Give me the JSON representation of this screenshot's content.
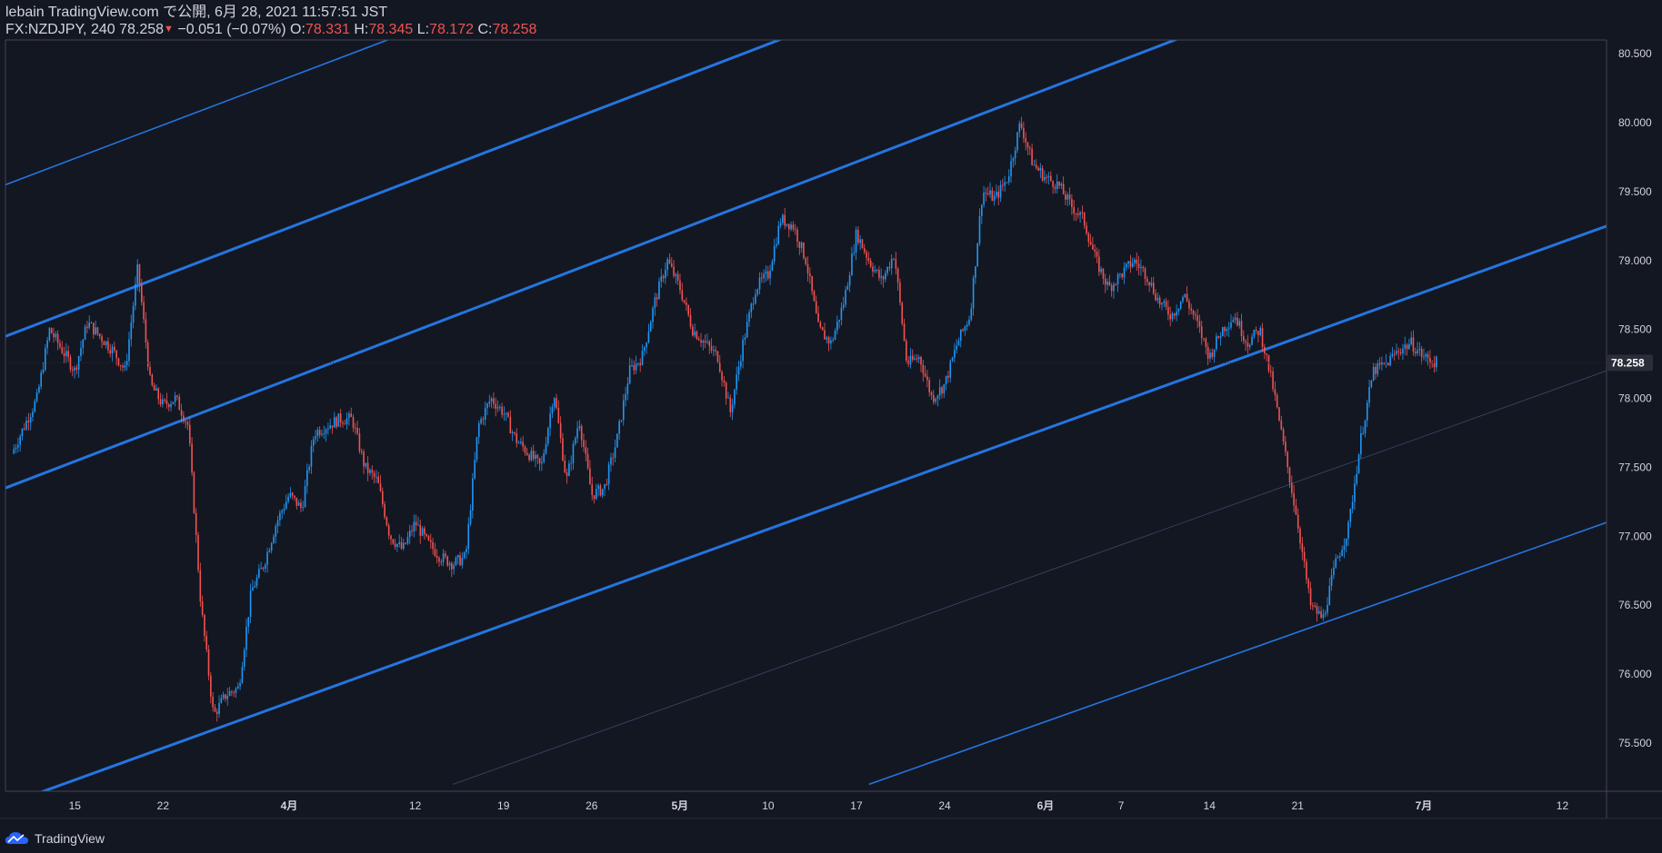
{
  "header": {
    "published_line": "lebain TradingView.com で公開, 6月 28, 2021 11:57:51 JST",
    "symbol": "FX:NZDJPY, 240",
    "last_price": "78.258",
    "change_arrow": "▼",
    "change": "−0.051 (−0.07%)",
    "o_label": "O:",
    "o_value": "78.331",
    "h_label": "H:",
    "h_value": "78.345",
    "l_label": "L:",
    "l_value": "78.172",
    "c_label": "C:",
    "c_value": "78.258"
  },
  "colors": {
    "background": "#131722",
    "up": "#2196f3",
    "down": "#ef5350",
    "channel": "#2575e0",
    "grid_text": "#d1d4dc",
    "price_label_bg": "#2a2e39"
  },
  "footer": {
    "brand": "TradingView",
    "logo_icon": "tradingview-cloud-icon"
  },
  "chart_data": {
    "type": "candlestick",
    "symbol": "FX:NZDJPY",
    "interval": "240",
    "ylim": [
      75.15,
      80.6
    ],
    "y_ticks": [
      75.5,
      76.0,
      76.5,
      77.0,
      77.5,
      78.0,
      78.5,
      79.0,
      79.5,
      80.0,
      80.5
    ],
    "y_tick_labels": [
      "75.500",
      "76.000",
      "76.500",
      "77.000",
      "77.500",
      "78.000",
      "78.500",
      "79.000",
      "79.500",
      "80.000",
      "80.500"
    ],
    "current_price": 78.258,
    "current_price_label": "78.258",
    "x_ticks": [
      {
        "label": "15",
        "day": 5
      },
      {
        "label": "22",
        "day": 12
      },
      {
        "label": "4月",
        "day": 22
      },
      {
        "label": "12",
        "day": 32
      },
      {
        "label": "19",
        "day": 39
      },
      {
        "label": "26",
        "day": 46
      },
      {
        "label": "5月",
        "day": 53
      },
      {
        "label": "10",
        "day": 60
      },
      {
        "label": "17",
        "day": 67
      },
      {
        "label": "24",
        "day": 74
      },
      {
        "label": "6月",
        "day": 82
      },
      {
        "label": "7",
        "day": 88
      },
      {
        "label": "14",
        "day": 95
      },
      {
        "label": "21",
        "day": 102
      },
      {
        "label": "7月",
        "day": 112
      },
      {
        "label": "12",
        "day": 123
      }
    ],
    "xlim": [
      -0.5,
      126.5
    ],
    "price_path": [
      [
        0,
        77.6
      ],
      [
        2,
        78.0
      ],
      [
        3,
        78.5
      ],
      [
        5,
        78.2
      ],
      [
        6,
        78.55
      ],
      [
        8,
        78.35
      ],
      [
        9,
        78.2
      ],
      [
        10,
        78.95
      ],
      [
        11,
        78.1
      ],
      [
        12,
        77.95
      ],
      [
        13,
        78.0
      ],
      [
        14,
        77.8
      ],
      [
        15,
        76.5
      ],
      [
        16,
        75.7
      ],
      [
        17,
        75.85
      ],
      [
        18,
        75.9
      ],
      [
        19,
        76.6
      ],
      [
        20,
        76.8
      ],
      [
        21,
        77.1
      ],
      [
        22,
        77.3
      ],
      [
        23,
        77.2
      ],
      [
        24,
        77.75
      ],
      [
        26,
        77.85
      ],
      [
        27,
        77.85
      ],
      [
        28,
        77.5
      ],
      [
        29,
        77.4
      ],
      [
        30,
        77.0
      ],
      [
        31,
        76.9
      ],
      [
        32,
        77.1
      ],
      [
        33,
        76.95
      ],
      [
        34,
        76.85
      ],
      [
        35,
        76.8
      ],
      [
        36,
        76.85
      ],
      [
        37,
        77.8
      ],
      [
        38,
        78.0
      ],
      [
        39,
        77.9
      ],
      [
        40,
        77.7
      ],
      [
        41,
        77.6
      ],
      [
        42,
        77.5
      ],
      [
        43,
        78.05
      ],
      [
        44,
        77.4
      ],
      [
        45,
        77.85
      ],
      [
        46,
        77.3
      ],
      [
        47,
        77.35
      ],
      [
        48,
        77.7
      ],
      [
        49,
        78.2
      ],
      [
        50,
        78.3
      ],
      [
        51,
        78.7
      ],
      [
        52,
        79.0
      ],
      [
        53,
        78.8
      ],
      [
        54,
        78.5
      ],
      [
        55,
        78.4
      ],
      [
        56,
        78.3
      ],
      [
        57,
        77.9
      ],
      [
        58,
        78.4
      ],
      [
        59,
        78.8
      ],
      [
        60,
        78.9
      ],
      [
        61,
        79.3
      ],
      [
        62,
        79.25
      ],
      [
        63,
        79.0
      ],
      [
        64,
        78.5
      ],
      [
        65,
        78.4
      ],
      [
        66,
        78.7
      ],
      [
        67,
        79.2
      ],
      [
        68,
        79.0
      ],
      [
        69,
        78.85
      ],
      [
        70,
        79.05
      ],
      [
        71,
        78.25
      ],
      [
        72,
        78.3
      ],
      [
        73,
        78.0
      ],
      [
        74,
        78.1
      ],
      [
        75,
        78.4
      ],
      [
        76,
        78.6
      ],
      [
        77,
        79.5
      ],
      [
        78,
        79.45
      ],
      [
        79,
        79.6
      ],
      [
        80,
        80.0
      ],
      [
        81,
        79.7
      ],
      [
        82,
        79.6
      ],
      [
        83,
        79.55
      ],
      [
        84,
        79.4
      ],
      [
        85,
        79.3
      ],
      [
        86,
        79.0
      ],
      [
        87,
        78.8
      ],
      [
        88,
        78.9
      ],
      [
        89,
        79.0
      ],
      [
        90,
        78.9
      ],
      [
        91,
        78.7
      ],
      [
        92,
        78.6
      ],
      [
        93,
        78.75
      ],
      [
        94,
        78.55
      ],
      [
        95,
        78.3
      ],
      [
        96,
        78.5
      ],
      [
        97,
        78.6
      ],
      [
        98,
        78.4
      ],
      [
        99,
        78.5
      ],
      [
        100,
        78.1
      ],
      [
        101,
        77.6
      ],
      [
        102,
        77.1
      ],
      [
        103,
        76.5
      ],
      [
        104,
        76.4
      ],
      [
        105,
        76.8
      ],
      [
        106,
        77.05
      ],
      [
        107,
        77.7
      ],
      [
        108,
        78.2
      ],
      [
        109,
        78.25
      ],
      [
        110,
        78.35
      ],
      [
        111,
        78.4
      ],
      [
        112,
        78.3
      ],
      [
        113,
        78.258
      ]
    ],
    "channel_lines": [
      {
        "style": "thick",
        "points": [
          [
            -0.5,
            78.45
          ],
          [
            126.5,
            82.9
          ]
        ]
      },
      {
        "style": "thin",
        "points": [
          [
            -0.5,
            79.55
          ],
          [
            126.5,
            83.95
          ]
        ]
      },
      {
        "style": "thick",
        "points": [
          [
            -0.5,
            77.35
          ],
          [
            126.5,
            81.8
          ]
        ]
      },
      {
        "style": "thick",
        "points": [
          [
            -0.5,
            75.05
          ],
          [
            126.5,
            79.25
          ]
        ]
      },
      {
        "style": "thin",
        "points": [
          [
            68,
            75.2
          ],
          [
            126.5,
            77.1
          ]
        ]
      },
      {
        "style": "faint",
        "points": [
          [
            35,
            75.2
          ],
          [
            126.5,
            78.2
          ]
        ]
      }
    ]
  }
}
